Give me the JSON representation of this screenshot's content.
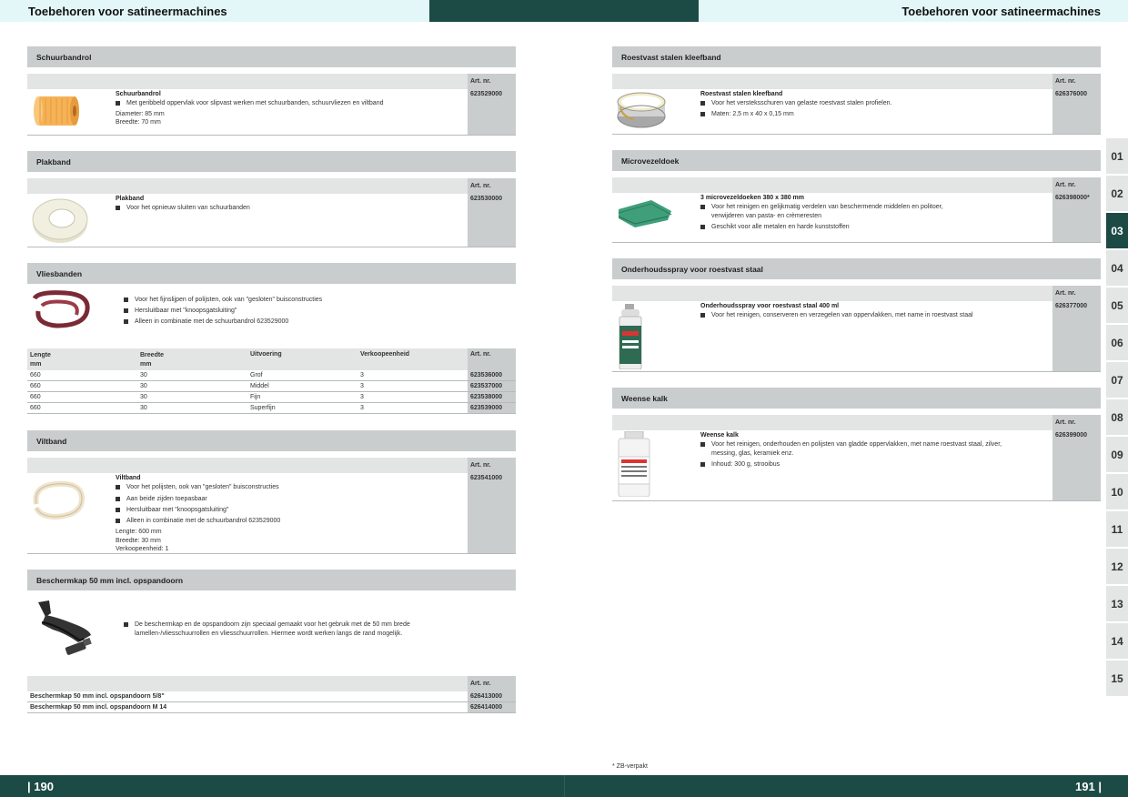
{
  "header": {
    "left_title": "Toebehoren voor satineermachines",
    "right_title": "Toebehoren voor satineermachines"
  },
  "footer": {
    "left_page": "| 190",
    "right_page": "191 |",
    "footnote": "* ZB-verpakt"
  },
  "art_label": "Art. nr.",
  "left": {
    "schuurbandrol": {
      "section": "Schuurbandrol",
      "title": "Schuurbandrol",
      "bullets": [
        "Met geribbeld oppervlak voor slipvast werken met schuurbanden, schuurvliezen en viltband"
      ],
      "specs": [
        "Diameter: 85 mm",
        "Breedte: 70 mm"
      ],
      "art": "623529000"
    },
    "plakband": {
      "section": "Plakband",
      "title": "Plakband",
      "bullets": [
        "Voor het opnieuw sluiten van schuurbanden"
      ],
      "art": "623530000"
    },
    "vliesbanden": {
      "section": "Vliesbanden",
      "bullets": [
        "Voor het fijnslijpen of polijsten, ook van \"gesloten\" buisconstructies",
        "Hersluitbaar met \"knoopsgatsluiting\"",
        "Alleen in combinatie met de schuurbandrol 623529000"
      ],
      "columns": [
        "Lengte mm",
        "Breedte mm",
        "Uitvoering",
        "Verkoopeenheid",
        "Art. nr."
      ],
      "col_lengte": "Lengte",
      "col_mm": "mm",
      "col_breedte": "Breedte",
      "rows": [
        [
          "660",
          "30",
          "Grof",
          "3",
          "623536000"
        ],
        [
          "660",
          "30",
          "Middel",
          "3",
          "623537000"
        ],
        [
          "660",
          "30",
          "Fijn",
          "3",
          "623538000"
        ],
        [
          "660",
          "30",
          "Superfijn",
          "3",
          "623539000"
        ]
      ]
    },
    "viltband": {
      "section": "Viltband",
      "title": "Viltband",
      "bullets": [
        "Voor het polijsten, ook van \"gesloten\" buisconstructies",
        "Aan beide zijden toepasbaar",
        "Hersluitbaar met \"knoopsgatsluiting\"",
        "Alleen in combinatie met de schuurbandrol 623529000"
      ],
      "specs": [
        "Lengte: 600 mm",
        "Breedte: 30 mm",
        "Verkoopeenheid: 1"
      ],
      "art": "623541000"
    },
    "beschermkap": {
      "section": "Beschermkap 50 mm incl. opspandoorn",
      "bullets": [
        "De beschermkap en de opspandoorn zijn speciaal gemaakt voor het gebruik met de 50 mm brede lamellen-/vliesschuurrollen en vliesschuurrollen. Hiermee wordt werken langs de rand mogelijk."
      ],
      "rows": [
        [
          "Beschermkap 50 mm incl. opspandoorn 5/8\"",
          "626413000"
        ],
        [
          "Beschermkap 50 mm incl. opspandoorn M 14",
          "626414000"
        ]
      ]
    }
  },
  "right": {
    "kleefband": {
      "section": "Roestvast stalen kleefband",
      "title": "Roestvast stalen kleefband",
      "bullets": [
        "Voor het versteksschuren van gelaste roestvast stalen profielen.",
        "Maten: 2,5 m x 40 x 0,15 mm"
      ],
      "art": "626376000"
    },
    "microvezeldoek": {
      "section": "Microvezeldoek",
      "title": "3 microvezeldoeken 380 x 380 mm",
      "bullets": [
        "Voor het reinigen en gelijkmatig verdelen van beschermende middelen en politoer, verwijderen van pasta- en crèmeresten",
        "Geschikt voor alle metalen en harde kunststoffen"
      ],
      "art": "626398000*"
    },
    "spray": {
      "section": "Onderhoudsspray voor roestvast staal",
      "title": "Onderhoudsspray voor roestvast staal 400 ml",
      "bullets": [
        "Voor het reinigen, conserveren en verzegelen van oppervlakken, met name in roestvast staal"
      ],
      "art": "626377000"
    },
    "kalk": {
      "section": "Weense kalk",
      "title": "Weense kalk",
      "bullets": [
        "Voor het reinigen, onderhouden en polijsten van gladde oppervlakken, met name roestvast staal, zilver, messing, glas, keramiek enz.",
        "Inhoud: 300 g, strooibus"
      ],
      "art": "626399000"
    }
  },
  "tabs": [
    "01",
    "02",
    "03",
    "04",
    "05",
    "06",
    "07",
    "08",
    "09",
    "10",
    "11",
    "12",
    "13",
    "14",
    "15"
  ],
  "active_tab": "03",
  "colors": {
    "dark": "#1c4a44",
    "light": "#e3f6f8",
    "section": "#c9cdcd"
  }
}
